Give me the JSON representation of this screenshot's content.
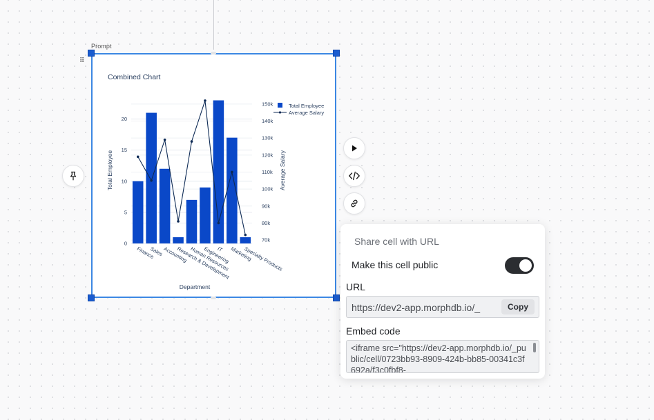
{
  "cell": {
    "prompt_label": "Prompt",
    "drag_handle_glyph": "⠿"
  },
  "chart_data": {
    "type": "bar",
    "title": "Combined Chart",
    "xlabel": "Department",
    "ylabel": "Total Employee",
    "y2label": "Average Salary",
    "categories": [
      "Finance",
      "Sales",
      "Accounting",
      "Research & Development",
      "Human Resources",
      "Engineering",
      "IT",
      "Marketing",
      "Specialty Products"
    ],
    "series": [
      {
        "name": "Total Employee",
        "kind": "bar",
        "axis": "y",
        "color": "#0a48c8",
        "values": [
          10,
          21,
          12,
          1,
          7,
          9,
          23,
          17,
          1
        ]
      },
      {
        "name": "Average Salary",
        "kind": "line",
        "axis": "y2",
        "color": "#0d2a55",
        "values": [
          119000,
          105000,
          129000,
          81000,
          128000,
          152000,
          80000,
          110000,
          73000
        ]
      }
    ],
    "ylim": [
      0,
      23.5
    ],
    "yticks": [
      0,
      5,
      10,
      15,
      20
    ],
    "y2lim": [
      68000,
      154000
    ],
    "y2ticks": [
      70000,
      80000,
      90000,
      100000,
      110000,
      120000,
      130000,
      140000,
      150000
    ],
    "y2ticklabels": [
      "70k",
      "80k",
      "90k",
      "100k",
      "110k",
      "120k",
      "130k",
      "140k",
      "150k"
    ],
    "legend_position": "top-right",
    "grid": true
  },
  "toolbar": {
    "run_icon": "play-icon",
    "code_icon": "code-icon",
    "share_icon": "link-icon",
    "pin_icon": "pin-icon"
  },
  "share": {
    "title": "Share cell with URL",
    "public_label": "Make this cell public",
    "public_enabled": true,
    "url_label": "URL",
    "url_value": "https://dev2-app.morphdb.io/_",
    "copy_label": "Copy",
    "embed_label": "Embed code",
    "embed_value": "<iframe src=\"https://dev2-app.morphdb.io/_public/cell/0723bb93-8909-424b-bb85-00341c3f692a/f3c0fbf8-"
  },
  "colors": {
    "accent": "#3b87e3",
    "handle": "#1a5ccf",
    "bar": "#0a48c8",
    "line": "#0d2a55",
    "toggle_on": "#2b2d31"
  }
}
